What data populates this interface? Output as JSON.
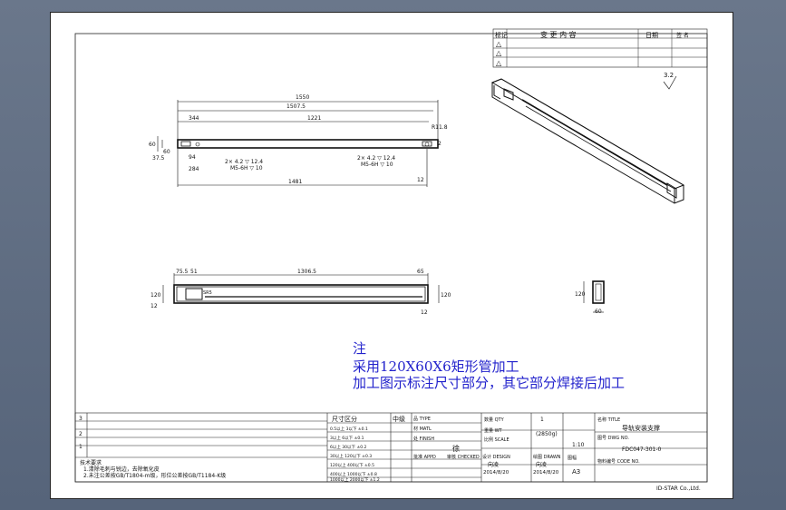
{
  "revision_table": {
    "headers": [
      "标记",
      "变 更 内 容",
      "日期",
      "签 名"
    ],
    "rows": [
      "△",
      "△",
      "△"
    ]
  },
  "surface_finish": "3.2",
  "front_view": {
    "dims": {
      "overall": "1550",
      "d1": "1507.5",
      "d2": "1221",
      "d3": "344",
      "d4": "R11.8",
      "d5": "60",
      "d6": "37.5",
      "d7": "12",
      "d8": "1481",
      "d9": "284",
      "d10": "94"
    },
    "hole_left": "2× 4.2  ▽ 12.4",
    "hole_left2": "M5-6H  ▽ 10",
    "hole_right": "2× 4.2  ▽ 12.4",
    "hole_right2": "M5-6H  ▽ 10",
    "left_small": "60",
    "left_small2": "2"
  },
  "top_view": {
    "dims": {
      "d1": "75.5",
      "d2": "51",
      "d3": "1306.5",
      "d4": "65",
      "d5": "120",
      "d6": "12",
      "d7": "120",
      "d8": "12",
      "d9": "SR5"
    }
  },
  "section_view": {
    "h": "120",
    "w": "60"
  },
  "notes": {
    "title": "注",
    "line1": "采用120X60X6矩形管加工",
    "line2": "加工图示标注尺寸部分，其它部分焊接后加工"
  },
  "title_block": {
    "tolerance_header": [
      "尺寸区分",
      "中级"
    ],
    "tolerance_rows": [
      "0.5以上 3以下 ±0.1",
      "3以上 6以下 ±0.1",
      "6以上 30以下 ±0.2",
      "30以上 120以下 ±0.3",
      "120以上 400以下 ±0.5",
      "400以上 1000以下 ±0.8",
      "1000以上 2000以下 ±1.2"
    ],
    "material_type": "品 TYPE",
    "material": "材 MATL",
    "finish": "处 FINISH",
    "qty_label": "数量 QTY",
    "qty": "1",
    "weight_label": "重量 WT",
    "weight": "(2850g)",
    "scale_label": "比例 SCALE",
    "scale": "1:10",
    "title_label": "名称 TITLE",
    "title": "导轨安装支撑",
    "drawing_no_label": "图号 DWG NO.",
    "drawing_no": "FDC047-301-0",
    "code_label": "物料编号 CODE NO.",
    "approved": "批准 APPD",
    "checked": "审核 CHECKED",
    "design": "设计 DESIGN",
    "drawn": "绘图 DRAWN",
    "approved_by": "",
    "checked_by": "徐",
    "design_by": "向凌",
    "drawn_by": "向凌",
    "date1": "2014/8/20",
    "date2": "2014/8/20",
    "size_label": "图幅",
    "size": "A3",
    "company": "ID-STAR Co.,Ltd."
  },
  "tech_req": {
    "header": "技术要求",
    "line1": "1.清除毛刺与锐边，去除氧化皮",
    "line2": "2.未注公差按GB/T1804-m级，形位公差按GB/T1184-K级"
  },
  "rev_left": [
    "3",
    "2",
    "1"
  ]
}
